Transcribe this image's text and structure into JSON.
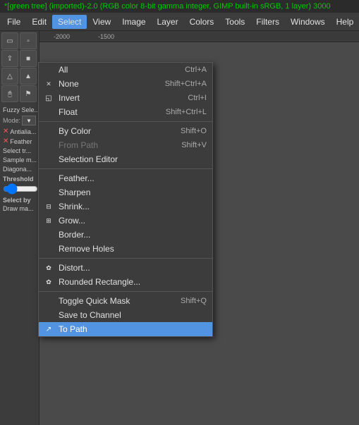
{
  "title": "*[green tree] (imported)-2.0 (RGB color 8-bit gamma integer, GIMP built-in sRGB, 1 layer) 3000",
  "menubar": {
    "items": [
      "File",
      "Edit",
      "Select",
      "View",
      "Image",
      "Layer",
      "Colors",
      "Tools",
      "Filters",
      "Windows",
      "Help"
    ]
  },
  "active_menu": "Select",
  "select_menu": {
    "items": [
      {
        "label": "All",
        "shortcut": "Ctrl+A",
        "icon": "",
        "disabled": false,
        "highlighted": false,
        "check": ""
      },
      {
        "label": "None",
        "shortcut": "Shift+Ctrl+A",
        "icon": "✕",
        "disabled": false,
        "highlighted": false,
        "check": ""
      },
      {
        "label": "Invert",
        "shortcut": "Ctrl+I",
        "icon": "◱",
        "disabled": false,
        "highlighted": false,
        "check": ""
      },
      {
        "label": "Float",
        "shortcut": "Shift+Ctrl+L",
        "icon": "",
        "disabled": false,
        "highlighted": false,
        "check": ""
      },
      {
        "sep": true
      },
      {
        "label": "By Color",
        "shortcut": "Shift+O",
        "icon": "",
        "disabled": false,
        "highlighted": false,
        "check": ""
      },
      {
        "label": "From Path",
        "shortcut": "Shift+V",
        "icon": "",
        "disabled": true,
        "highlighted": false,
        "check": ""
      },
      {
        "label": "Selection Editor",
        "shortcut": "",
        "icon": "",
        "disabled": false,
        "highlighted": false,
        "check": ""
      },
      {
        "sep": true
      },
      {
        "label": "Feather...",
        "shortcut": "",
        "icon": "",
        "disabled": false,
        "highlighted": false,
        "check": ""
      },
      {
        "label": "Sharpen",
        "shortcut": "",
        "icon": "",
        "disabled": false,
        "highlighted": false,
        "check": ""
      },
      {
        "label": "Shrink...",
        "shortcut": "",
        "icon": "",
        "disabled": false,
        "highlighted": false,
        "check": ""
      },
      {
        "label": "Grow...",
        "shortcut": "",
        "icon": "",
        "disabled": false,
        "highlighted": false,
        "check": ""
      },
      {
        "label": "Border...",
        "shortcut": "",
        "icon": "",
        "disabled": false,
        "highlighted": false,
        "check": ""
      },
      {
        "label": "Remove Holes",
        "shortcut": "",
        "icon": "",
        "disabled": false,
        "highlighted": false,
        "check": ""
      },
      {
        "sep": true
      },
      {
        "label": "Distort...",
        "shortcut": "",
        "icon": "✿",
        "disabled": false,
        "highlighted": false,
        "check": ""
      },
      {
        "label": "Rounded Rectangle...",
        "shortcut": "",
        "icon": "✿",
        "disabled": false,
        "highlighted": false,
        "check": ""
      },
      {
        "sep": true
      },
      {
        "label": "Toggle Quick Mask",
        "shortcut": "Shift+Q",
        "icon": "",
        "disabled": false,
        "highlighted": false,
        "check": ""
      },
      {
        "label": "Save to Channel",
        "shortcut": "",
        "icon": "",
        "disabled": false,
        "highlighted": false,
        "check": ""
      },
      {
        "label": "To Path",
        "shortcut": "",
        "icon": "↗",
        "disabled": false,
        "highlighted": true,
        "check": ""
      }
    ]
  },
  "left_panel": {
    "mode_label": "Mode:",
    "antialias_label": "Antialia...",
    "feather_label": "Feather",
    "select_tr_label": "Select tr...",
    "sample_label": "Sample m...",
    "diagonal_label": "Diagona...",
    "threshold_label": "Threshold",
    "select_by_label": "Select by",
    "draw_mask_label": "Draw ma..."
  },
  "ruler": {
    "marks": [
      "-2000",
      "-1500"
    ]
  },
  "colors": {
    "accent": "#5294e2"
  }
}
